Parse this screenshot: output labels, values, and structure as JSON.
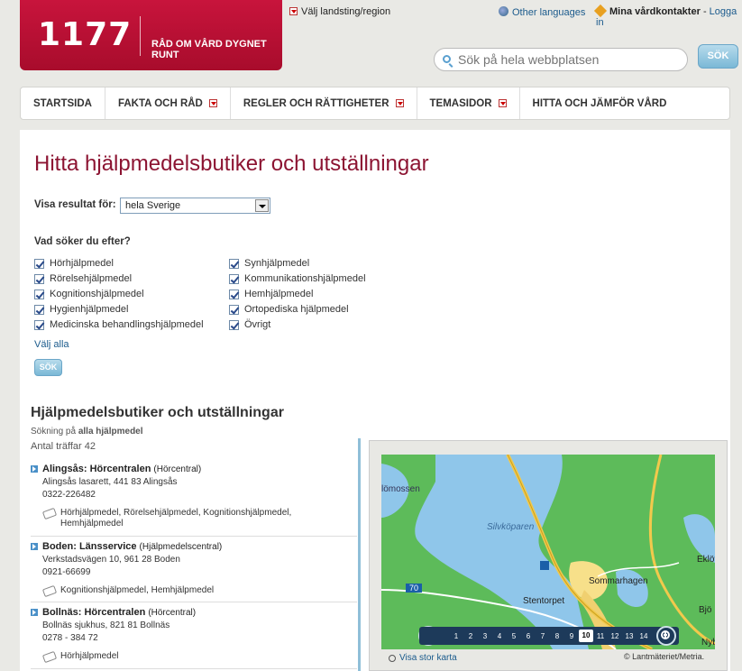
{
  "header": {
    "logo_number": "1177",
    "logo_tagline": "RÅD OM VÅRD DYGNET RUNT",
    "region_link": "Välj landsting/region",
    "other_languages": "Other languages",
    "contacts_label": "Mina vårdkontakter",
    "contacts_separator": "-",
    "login_label": "Logga in",
    "search_placeholder": "Sök på hela webbplatsen",
    "search_button": "SÖK"
  },
  "nav": {
    "items": [
      {
        "label": "STARTSIDA",
        "has_dropdown": false
      },
      {
        "label": "FAKTA OCH RÅD",
        "has_dropdown": true
      },
      {
        "label": "REGLER OCH RÄTTIGHETER",
        "has_dropdown": true
      },
      {
        "label": "TEMASIDOR",
        "has_dropdown": true
      },
      {
        "label": "HITTA OCH JÄMFÖR VÅRD",
        "has_dropdown": false
      }
    ]
  },
  "form": {
    "page_title": "Hitta hjälpmedelsbutiker och utställningar",
    "show_results_label": "Visa resultat för:",
    "region_selected": "hela Sverige",
    "question": "Vad söker du efter?",
    "categories_left": [
      "Hörhjälpmedel",
      "Rörelsehjälpmedel",
      "Kognitionshjälpmedel",
      "Hygienhjälpmedel",
      "Medicinska behandlingshjälpmedel"
    ],
    "categories_right": [
      "Synhjälpmedel",
      "Kommunikationshjälpmedel",
      "Hemhjälpmedel",
      "Ortopediska hjälpmedel",
      "Övrigt"
    ],
    "select_all": "Välj alla",
    "search_button": "SÖK"
  },
  "results": {
    "heading": "Hjälpmedelsbutiker och utställningar",
    "search_on_prefix": "Sökning på",
    "search_on_value": "alla hjälpmedel",
    "count_text": "Antal träffar 42",
    "items": [
      {
        "name": "Alingsås: Hörcentralen",
        "type": "(Hörcentral)",
        "address": "Alingsås lasarett, 441 83 Alingsås",
        "phone": "0322-226482",
        "categories": "Hörhjälpmedel, Rörelsehjälpmedel, Kognitionshjälpmedel, Hemhjälpmedel"
      },
      {
        "name": "Boden: Länsservice",
        "type": "(Hjälpmedelscentral)",
        "address": "Verkstadsvägen 10, 961 28 Boden",
        "phone": "0921-66699",
        "categories": "Kognitionshjälpmedel, Hemhjälpmedel"
      },
      {
        "name": "Bollnäs: Hörcentralen",
        "type": "(Hörcentral)",
        "address": "Bollnäs sjukhus, 821 81 Bollnäs",
        "phone": "0278 - 384 72",
        "categories": "Hörhjälpmedel"
      }
    ]
  },
  "map": {
    "labels": {
      "lomossen": "lömossen",
      "silvkoparen": "Silvköparen",
      "sommarhagen": "Sommarhagen",
      "stentorpet": "Stentorpet",
      "road": "70",
      "eklov": "Eklöv",
      "bjo": "Bjö",
      "nyb": "Nyb"
    },
    "zoom_levels": [
      "1",
      "2",
      "3",
      "4",
      "5",
      "6",
      "7",
      "8",
      "9",
      "10",
      "11",
      "12",
      "13",
      "14"
    ],
    "zoom_selected": "10",
    "show_large_map": "Visa stor karta",
    "copyright": "© Lantmäteriet/Metria."
  }
}
